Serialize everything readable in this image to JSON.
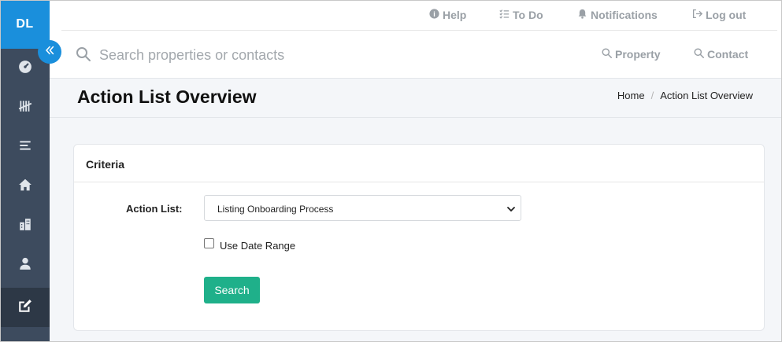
{
  "brand": {
    "initials": "DL"
  },
  "sidebar": {
    "items": [
      {
        "icon": "dashboard-icon"
      },
      {
        "icon": "tally-icon"
      },
      {
        "icon": "list-icon"
      },
      {
        "icon": "home-icon"
      },
      {
        "icon": "building-icon"
      },
      {
        "icon": "user-icon"
      },
      {
        "icon": "edit-icon",
        "active": true
      }
    ]
  },
  "topbar": {
    "help": "Help",
    "todo": "To Do",
    "notifications": "Notifications",
    "logout": "Log out"
  },
  "search": {
    "placeholder": "Search properties or contacts",
    "value": "",
    "filter_property": "Property",
    "filter_contact": "Contact"
  },
  "page": {
    "title": "Action List Overview",
    "breadcrumb": [
      "Home",
      "Action List Overview"
    ]
  },
  "criteria": {
    "title": "Criteria",
    "action_list_label": "Action List:",
    "action_list_value": "Listing Onboarding Process",
    "date_range_label": "Use Date Range",
    "date_range_checked": false,
    "search_button": "Search"
  },
  "colors": {
    "accent": "#1a8fdc",
    "sidebar": "#3d4b5e",
    "button": "#1fb08a"
  }
}
